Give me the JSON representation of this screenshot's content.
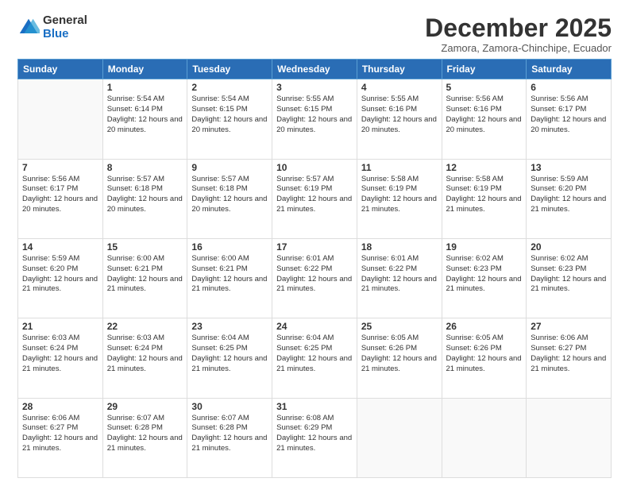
{
  "logo": {
    "general": "General",
    "blue": "Blue"
  },
  "header": {
    "month": "December 2025",
    "location": "Zamora, Zamora-Chinchipe, Ecuador"
  },
  "days_of_week": [
    "Sunday",
    "Monday",
    "Tuesday",
    "Wednesday",
    "Thursday",
    "Friday",
    "Saturday"
  ],
  "weeks": [
    [
      {
        "day": "",
        "info": ""
      },
      {
        "day": "1",
        "info": "Sunrise: 5:54 AM\nSunset: 6:14 PM\nDaylight: 12 hours\nand 20 minutes."
      },
      {
        "day": "2",
        "info": "Sunrise: 5:54 AM\nSunset: 6:15 PM\nDaylight: 12 hours\nand 20 minutes."
      },
      {
        "day": "3",
        "info": "Sunrise: 5:55 AM\nSunset: 6:15 PM\nDaylight: 12 hours\nand 20 minutes."
      },
      {
        "day": "4",
        "info": "Sunrise: 5:55 AM\nSunset: 6:16 PM\nDaylight: 12 hours\nand 20 minutes."
      },
      {
        "day": "5",
        "info": "Sunrise: 5:56 AM\nSunset: 6:16 PM\nDaylight: 12 hours\nand 20 minutes."
      },
      {
        "day": "6",
        "info": "Sunrise: 5:56 AM\nSunset: 6:17 PM\nDaylight: 12 hours\nand 20 minutes."
      }
    ],
    [
      {
        "day": "7",
        "info": "Sunrise: 5:56 AM\nSunset: 6:17 PM\nDaylight: 12 hours\nand 20 minutes."
      },
      {
        "day": "8",
        "info": "Sunrise: 5:57 AM\nSunset: 6:18 PM\nDaylight: 12 hours\nand 20 minutes."
      },
      {
        "day": "9",
        "info": "Sunrise: 5:57 AM\nSunset: 6:18 PM\nDaylight: 12 hours\nand 20 minutes."
      },
      {
        "day": "10",
        "info": "Sunrise: 5:57 AM\nSunset: 6:19 PM\nDaylight: 12 hours\nand 21 minutes."
      },
      {
        "day": "11",
        "info": "Sunrise: 5:58 AM\nSunset: 6:19 PM\nDaylight: 12 hours\nand 21 minutes."
      },
      {
        "day": "12",
        "info": "Sunrise: 5:58 AM\nSunset: 6:19 PM\nDaylight: 12 hours\nand 21 minutes."
      },
      {
        "day": "13",
        "info": "Sunrise: 5:59 AM\nSunset: 6:20 PM\nDaylight: 12 hours\nand 21 minutes."
      }
    ],
    [
      {
        "day": "14",
        "info": "Sunrise: 5:59 AM\nSunset: 6:20 PM\nDaylight: 12 hours\nand 21 minutes."
      },
      {
        "day": "15",
        "info": "Sunrise: 6:00 AM\nSunset: 6:21 PM\nDaylight: 12 hours\nand 21 minutes."
      },
      {
        "day": "16",
        "info": "Sunrise: 6:00 AM\nSunset: 6:21 PM\nDaylight: 12 hours\nand 21 minutes."
      },
      {
        "day": "17",
        "info": "Sunrise: 6:01 AM\nSunset: 6:22 PM\nDaylight: 12 hours\nand 21 minutes."
      },
      {
        "day": "18",
        "info": "Sunrise: 6:01 AM\nSunset: 6:22 PM\nDaylight: 12 hours\nand 21 minutes."
      },
      {
        "day": "19",
        "info": "Sunrise: 6:02 AM\nSunset: 6:23 PM\nDaylight: 12 hours\nand 21 minutes."
      },
      {
        "day": "20",
        "info": "Sunrise: 6:02 AM\nSunset: 6:23 PM\nDaylight: 12 hours\nand 21 minutes."
      }
    ],
    [
      {
        "day": "21",
        "info": "Sunrise: 6:03 AM\nSunset: 6:24 PM\nDaylight: 12 hours\nand 21 minutes."
      },
      {
        "day": "22",
        "info": "Sunrise: 6:03 AM\nSunset: 6:24 PM\nDaylight: 12 hours\nand 21 minutes."
      },
      {
        "day": "23",
        "info": "Sunrise: 6:04 AM\nSunset: 6:25 PM\nDaylight: 12 hours\nand 21 minutes."
      },
      {
        "day": "24",
        "info": "Sunrise: 6:04 AM\nSunset: 6:25 PM\nDaylight: 12 hours\nand 21 minutes."
      },
      {
        "day": "25",
        "info": "Sunrise: 6:05 AM\nSunset: 6:26 PM\nDaylight: 12 hours\nand 21 minutes."
      },
      {
        "day": "26",
        "info": "Sunrise: 6:05 AM\nSunset: 6:26 PM\nDaylight: 12 hours\nand 21 minutes."
      },
      {
        "day": "27",
        "info": "Sunrise: 6:06 AM\nSunset: 6:27 PM\nDaylight: 12 hours\nand 21 minutes."
      }
    ],
    [
      {
        "day": "28",
        "info": "Sunrise: 6:06 AM\nSunset: 6:27 PM\nDaylight: 12 hours\nand 21 minutes."
      },
      {
        "day": "29",
        "info": "Sunrise: 6:07 AM\nSunset: 6:28 PM\nDaylight: 12 hours\nand 21 minutes."
      },
      {
        "day": "30",
        "info": "Sunrise: 6:07 AM\nSunset: 6:28 PM\nDaylight: 12 hours\nand 21 minutes."
      },
      {
        "day": "31",
        "info": "Sunrise: 6:08 AM\nSunset: 6:29 PM\nDaylight: 12 hours\nand 21 minutes."
      },
      {
        "day": "",
        "info": ""
      },
      {
        "day": "",
        "info": ""
      },
      {
        "day": "",
        "info": ""
      }
    ]
  ]
}
